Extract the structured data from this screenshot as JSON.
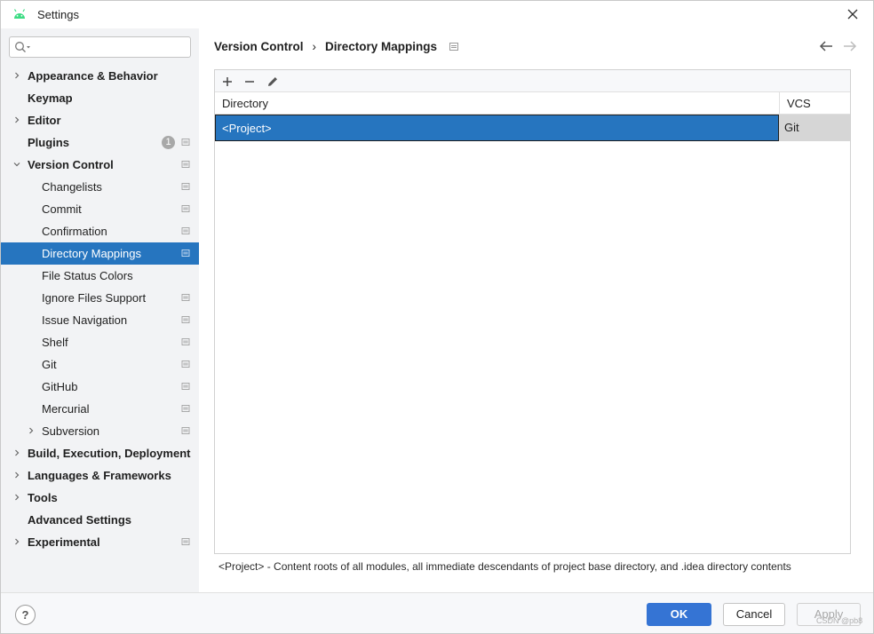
{
  "window": {
    "title": "Settings"
  },
  "search": {
    "placeholder": ""
  },
  "sidebar": {
    "items": [
      {
        "label": "Appearance & Behavior",
        "bold": true,
        "level": 0,
        "expandable": true,
        "expanded": false,
        "config": false
      },
      {
        "label": "Keymap",
        "bold": true,
        "level": 0,
        "expandable": false,
        "config": false
      },
      {
        "label": "Editor",
        "bold": true,
        "level": 0,
        "expandable": true,
        "expanded": false,
        "config": false
      },
      {
        "label": "Plugins",
        "bold": true,
        "level": 0,
        "expandable": false,
        "config": true,
        "badge": "1"
      },
      {
        "label": "Version Control",
        "bold": true,
        "level": 0,
        "expandable": true,
        "expanded": true,
        "config": true
      },
      {
        "label": "Changelists",
        "bold": false,
        "level": 1,
        "expandable": false,
        "config": true
      },
      {
        "label": "Commit",
        "bold": false,
        "level": 1,
        "expandable": false,
        "config": true
      },
      {
        "label": "Confirmation",
        "bold": false,
        "level": 1,
        "expandable": false,
        "config": true
      },
      {
        "label": "Directory Mappings",
        "bold": false,
        "level": 1,
        "expandable": false,
        "config": true,
        "selected": true
      },
      {
        "label": "File Status Colors",
        "bold": false,
        "level": 1,
        "expandable": false,
        "config": false
      },
      {
        "label": "Ignore Files Support",
        "bold": false,
        "level": 1,
        "expandable": false,
        "config": true
      },
      {
        "label": "Issue Navigation",
        "bold": false,
        "level": 1,
        "expandable": false,
        "config": true
      },
      {
        "label": "Shelf",
        "bold": false,
        "level": 1,
        "expandable": false,
        "config": true
      },
      {
        "label": "Git",
        "bold": false,
        "level": 1,
        "expandable": false,
        "config": true
      },
      {
        "label": "GitHub",
        "bold": false,
        "level": 1,
        "expandable": false,
        "config": true
      },
      {
        "label": "Mercurial",
        "bold": false,
        "level": 1,
        "expandable": false,
        "config": true
      },
      {
        "label": "Subversion",
        "bold": false,
        "level": 1,
        "expandable": true,
        "expanded": false,
        "config": true
      },
      {
        "label": "Build, Execution, Deployment",
        "bold": true,
        "level": 0,
        "expandable": true,
        "expanded": false,
        "config": false
      },
      {
        "label": "Languages & Frameworks",
        "bold": true,
        "level": 0,
        "expandable": true,
        "expanded": false,
        "config": false
      },
      {
        "label": "Tools",
        "bold": true,
        "level": 0,
        "expandable": true,
        "expanded": false,
        "config": false
      },
      {
        "label": "Advanced Settings",
        "bold": true,
        "level": 0,
        "expandable": false,
        "config": false
      },
      {
        "label": "Experimental",
        "bold": true,
        "level": 0,
        "expandable": true,
        "expanded": false,
        "config": true
      }
    ]
  },
  "breadcrumb": {
    "parent": "Version Control",
    "separator": "›",
    "current": "Directory Mappings"
  },
  "table": {
    "columns": [
      "Directory",
      "VCS"
    ],
    "rows": [
      {
        "directory": "<Project>",
        "vcs": "Git",
        "selected": true
      }
    ]
  },
  "footnote": "<Project> - Content roots of all modules, all immediate descendants of project base directory, and .idea directory contents",
  "buttons": {
    "help": "?",
    "ok": "OK",
    "cancel": "Cancel",
    "apply": "Apply"
  },
  "watermark": "CSDN @pb8",
  "colors": {
    "accent": "#2675bf",
    "ok_button": "#3574d4",
    "android_green": "#3ddc84"
  }
}
